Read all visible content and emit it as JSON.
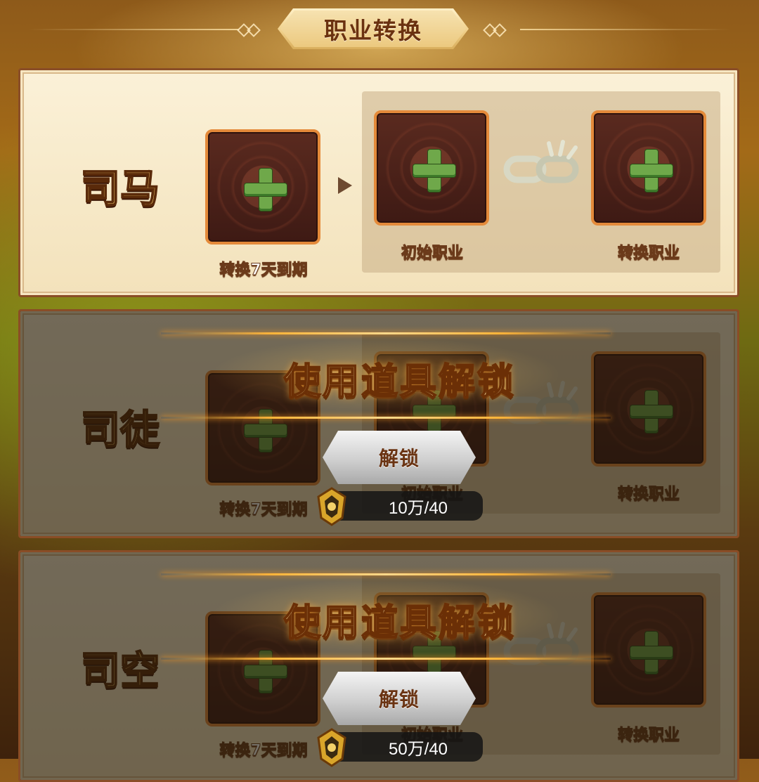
{
  "header": {
    "title": "职业转换"
  },
  "slot_labels": {
    "expire": "转换7天到期",
    "initial": "初始职业",
    "convert": "转换职业"
  },
  "rows": [
    {
      "name": "司马",
      "locked": false
    },
    {
      "name": "司徒",
      "locked": true,
      "unlock_title": "使用道具解锁",
      "unlock_button": "解锁",
      "cost": "10万/40"
    },
    {
      "name": "司空",
      "locked": true,
      "unlock_title": "使用道具解锁",
      "unlock_button": "解锁",
      "cost": "50万/40"
    }
  ],
  "icons": {
    "add": "plus-icon",
    "arrow": "arrow-right-icon",
    "link": "chain-link-icon",
    "currency": "crest-coin-icon"
  },
  "colors": {
    "accent_gold": "#f3c86a",
    "plus_green": "#6fa84a",
    "slot_border": "#e48a3a",
    "panel_bg": "#fbf1d8"
  }
}
